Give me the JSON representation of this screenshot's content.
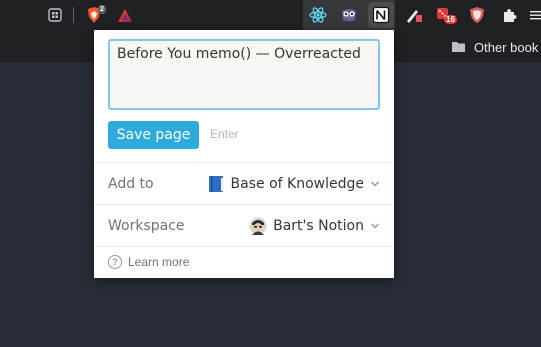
{
  "toolbar": {
    "icons": [
      "tab-search-icon",
      "brave-shield-icon",
      "brave-rewards-icon",
      "react-devtools-icon",
      "owl-extension-icon",
      "notion-clipper-icon",
      "pen-tool-icon",
      "dice-extension-icon",
      "shield-extension-icon",
      "extensions-puzzle-icon",
      "menu-icon"
    ],
    "brave_badge": "2",
    "dice_badge": "16"
  },
  "bookmarks_bar": {
    "other_bookmarks_label": "Other book"
  },
  "popup": {
    "title_value": "Before You memo() — Overreacted",
    "save_label": "Save page",
    "enter_hint": "Enter",
    "add_to_label": "Add to",
    "add_to_value": "Base of Knowledge",
    "workspace_label": "Workspace",
    "workspace_value": "Bart's Notion",
    "learn_more_label": "Learn more"
  },
  "colors": {
    "accent": "#2eaadc",
    "focus_border": "#84c4e8",
    "page_background": "#282c36",
    "chrome_background": "#202124"
  }
}
